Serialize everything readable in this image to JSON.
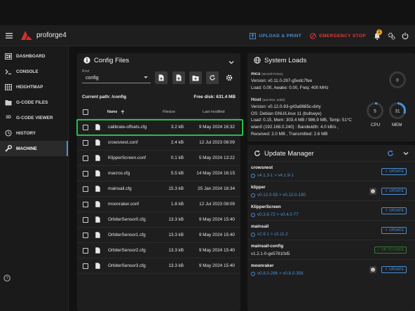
{
  "app": {
    "brand": "proforge4",
    "upload_label": "UPLOAD & PRINT",
    "emergency_label": "EMERGENCY STOP",
    "notification_count": "1"
  },
  "sidebar": {
    "items": [
      {
        "label": "DASHBOARD",
        "icon": "dashboard-icon"
      },
      {
        "label": "CONSOLE",
        "icon": "console-icon"
      },
      {
        "label": "HEIGHTMAP",
        "icon": "heightmap-icon"
      },
      {
        "label": "G-CODE FILES",
        "icon": "gcode-files-icon"
      },
      {
        "label": "G-CODE VIEWER",
        "icon": "3d-icon",
        "glyph": "3D"
      },
      {
        "label": "HISTORY",
        "icon": "history-icon"
      },
      {
        "label": "MACHINE",
        "icon": "wrench-icon",
        "active": true
      }
    ]
  },
  "files": {
    "title": "Config Files",
    "root_label": "Root",
    "root_value": "config",
    "current_path": "Current path: /config",
    "free_disk": "Free disk: 631.4 MB",
    "columns": {
      "name": "Name",
      "size": "Filesize",
      "modified": "Last modified"
    },
    "rows": [
      {
        "name": "calibrate-offsets.cfg",
        "size": "3.2 kB",
        "modified": "9 May 2024 16:32"
      },
      {
        "name": "crowsnest.conf",
        "size": "2.4 kB",
        "modified": "12 Jul 2023 08:09"
      },
      {
        "name": "KlipperScreen.conf",
        "size": "0.1 kB",
        "modified": "5 May 2024 13:22"
      },
      {
        "name": "macros.cfg",
        "size": "5.5 kB",
        "modified": "14 May 2024 16:15"
      },
      {
        "name": "mainsail.cfg",
        "size": "15.3 kB",
        "modified": "25 Jan 2024 16:34"
      },
      {
        "name": "moonraker.conf",
        "size": "1.8 kB",
        "modified": "12 Jul 2023 08:09"
      },
      {
        "name": "OrbiterSensor0.cfg",
        "size": "13.3 kB",
        "modified": "9 May 2024 15:40"
      },
      {
        "name": "OrbiterSensor1.cfg",
        "size": "13.3 kB",
        "modified": "9 May 2024 15:40"
      },
      {
        "name": "OrbiterSensor2.cfg",
        "size": "13.3 kB",
        "modified": "9 May 2024 15:40"
      },
      {
        "name": "OrbiterSensor3.cfg",
        "size": "13.3 kB",
        "modified": "9 May 2024 15:40"
      }
    ]
  },
  "loads": {
    "title": "System Loads",
    "mcu": {
      "name": "mcu",
      "chip": "(stm32h723xx)",
      "lines": [
        "Version: v0.11.0-297-g5edc7fee",
        "Load: 0.00, Awake: 0.00, Freq: 400 MHz"
      ],
      "gauge": 0
    },
    "host": {
      "name": "Host",
      "arch": "(aarch64, 64bit)",
      "lines": [
        "Version: v0.12.0-93-g43a9685c-dirty",
        "OS: Debian GNU/Linux 11 (bullseye)",
        "Load: 0.15, Mem: 303.4 MB / 986.9 MB, Temp: 51°C",
        "wlan0 (192.168.0.240) : Bandwidth: 4.0 kB/s ,",
        "Received: 2.0 MB , Transmitted: 2.6 MB"
      ],
      "cpu": 5,
      "mem": 31,
      "cpu_label": "CPU",
      "mem_label": "MEM"
    }
  },
  "updates": {
    "title": "Update Manager",
    "update_label": "UPDATE",
    "uptodate_label": "UP-TO-DATE",
    "items": [
      {
        "name": "crowsnest",
        "version": "v4.1.3-1 > v4.1.9-1",
        "status": "update",
        "info": false
      },
      {
        "name": "klipper",
        "version": "v0.12.0-93 > v0.12.0-190",
        "status": "update",
        "info": true
      },
      {
        "name": "KlipperScreen",
        "version": "v0.3.8-72 > v0.4.0-77",
        "status": "update",
        "info": false
      },
      {
        "name": "mainsail",
        "version": "v2.9.1 > v2.11.2",
        "status": "update",
        "info": false
      },
      {
        "name": "mainsail-config",
        "version": "v1.2.1-0-ge57810d5",
        "status": "uptodate",
        "info": false
      },
      {
        "name": "moonraker",
        "version": "v0.8.0-286 > v0.8.0-358",
        "status": "update",
        "info": true
      }
    ]
  },
  "colors": {
    "accent": "#4a90d9",
    "danger": "#e53935",
    "highlight": "#1ec24a",
    "ok": "#2e7d32"
  }
}
